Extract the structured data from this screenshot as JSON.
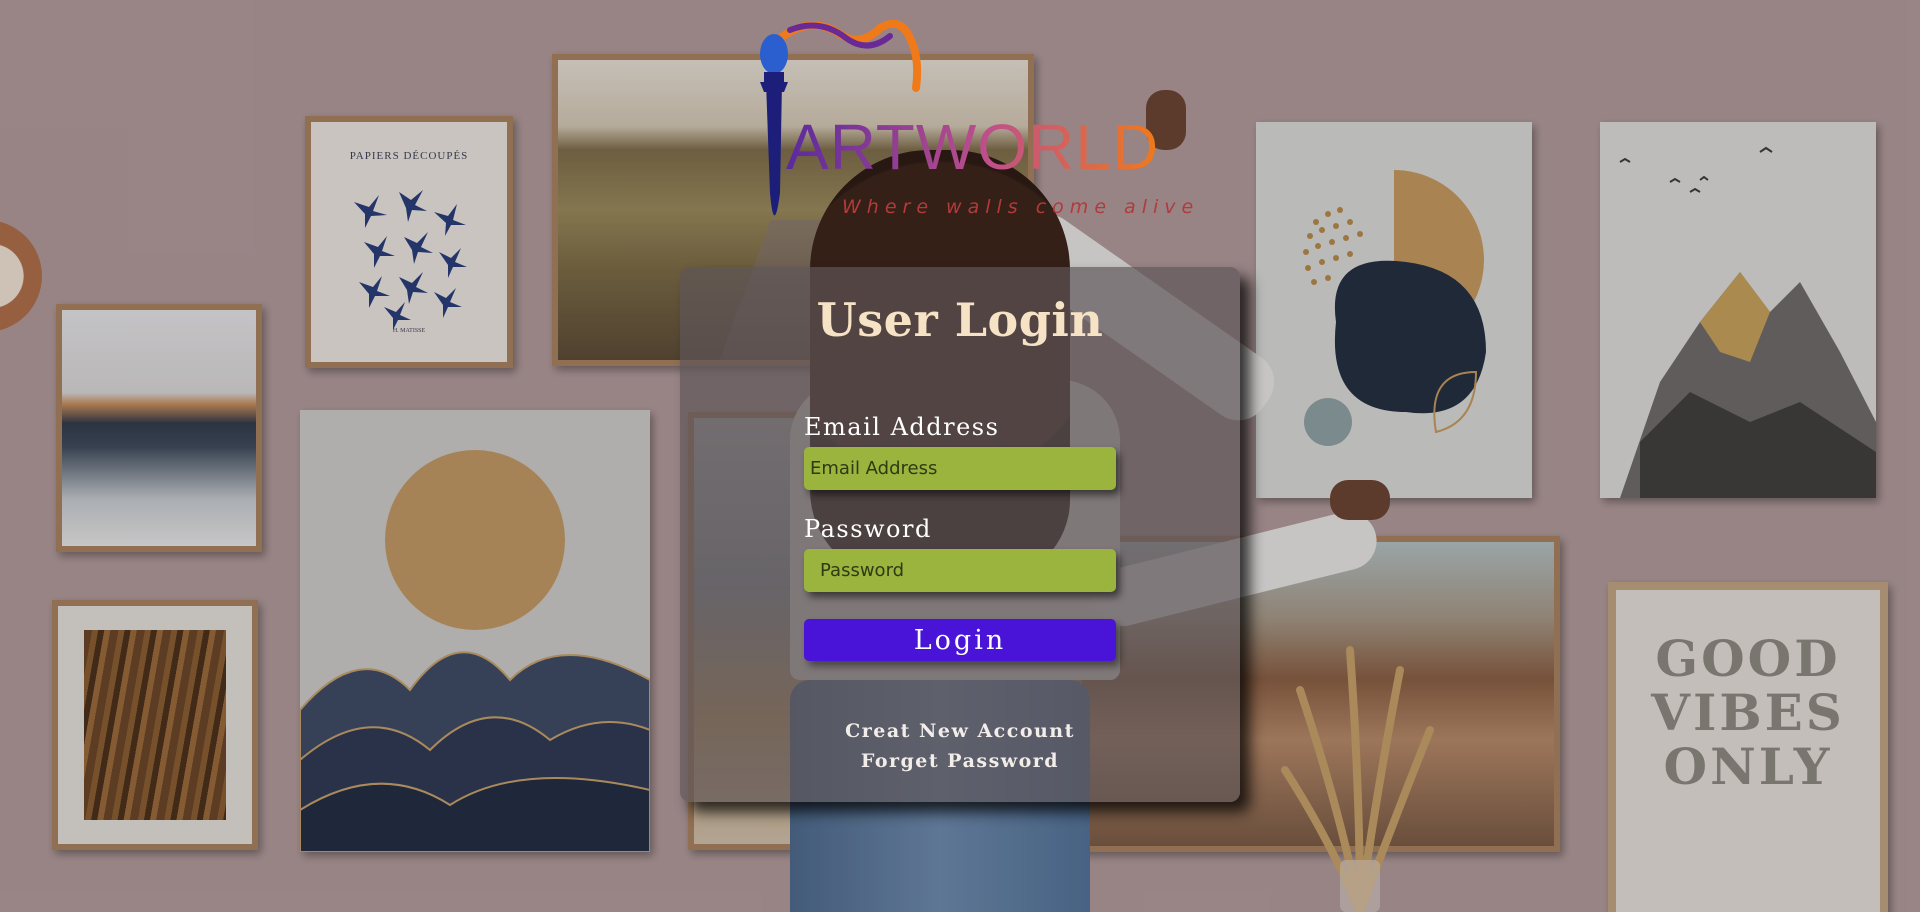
{
  "brand": {
    "logo_text": "ARTWORLD",
    "tagline": "Where walls come alive"
  },
  "wall_art": {
    "poster_title": "PAPIERS DÉCOUPÉS",
    "poster_sub": "H. MATISSE",
    "good_vibes_lines": [
      "GOOD",
      "VIBES",
      "ONLY"
    ]
  },
  "login_form": {
    "title": "User Login",
    "email": {
      "label": "Email Address",
      "placeholder": "Email Address",
      "value": ""
    },
    "password": {
      "label": "Password",
      "placeholder": "Password",
      "value": ""
    },
    "submit_label": "Login",
    "create_account_link": "Creat New Account",
    "forgot_password_link": "Forget Password"
  },
  "colors": {
    "card_title": "#f6e2c4",
    "input_bg": "#9bb43e",
    "button_bg": "#4a14d8",
    "tagline": "#b33a3a",
    "logo_gradient_start": "#5b2a9e",
    "logo_gradient_end": "#f07a1a"
  }
}
